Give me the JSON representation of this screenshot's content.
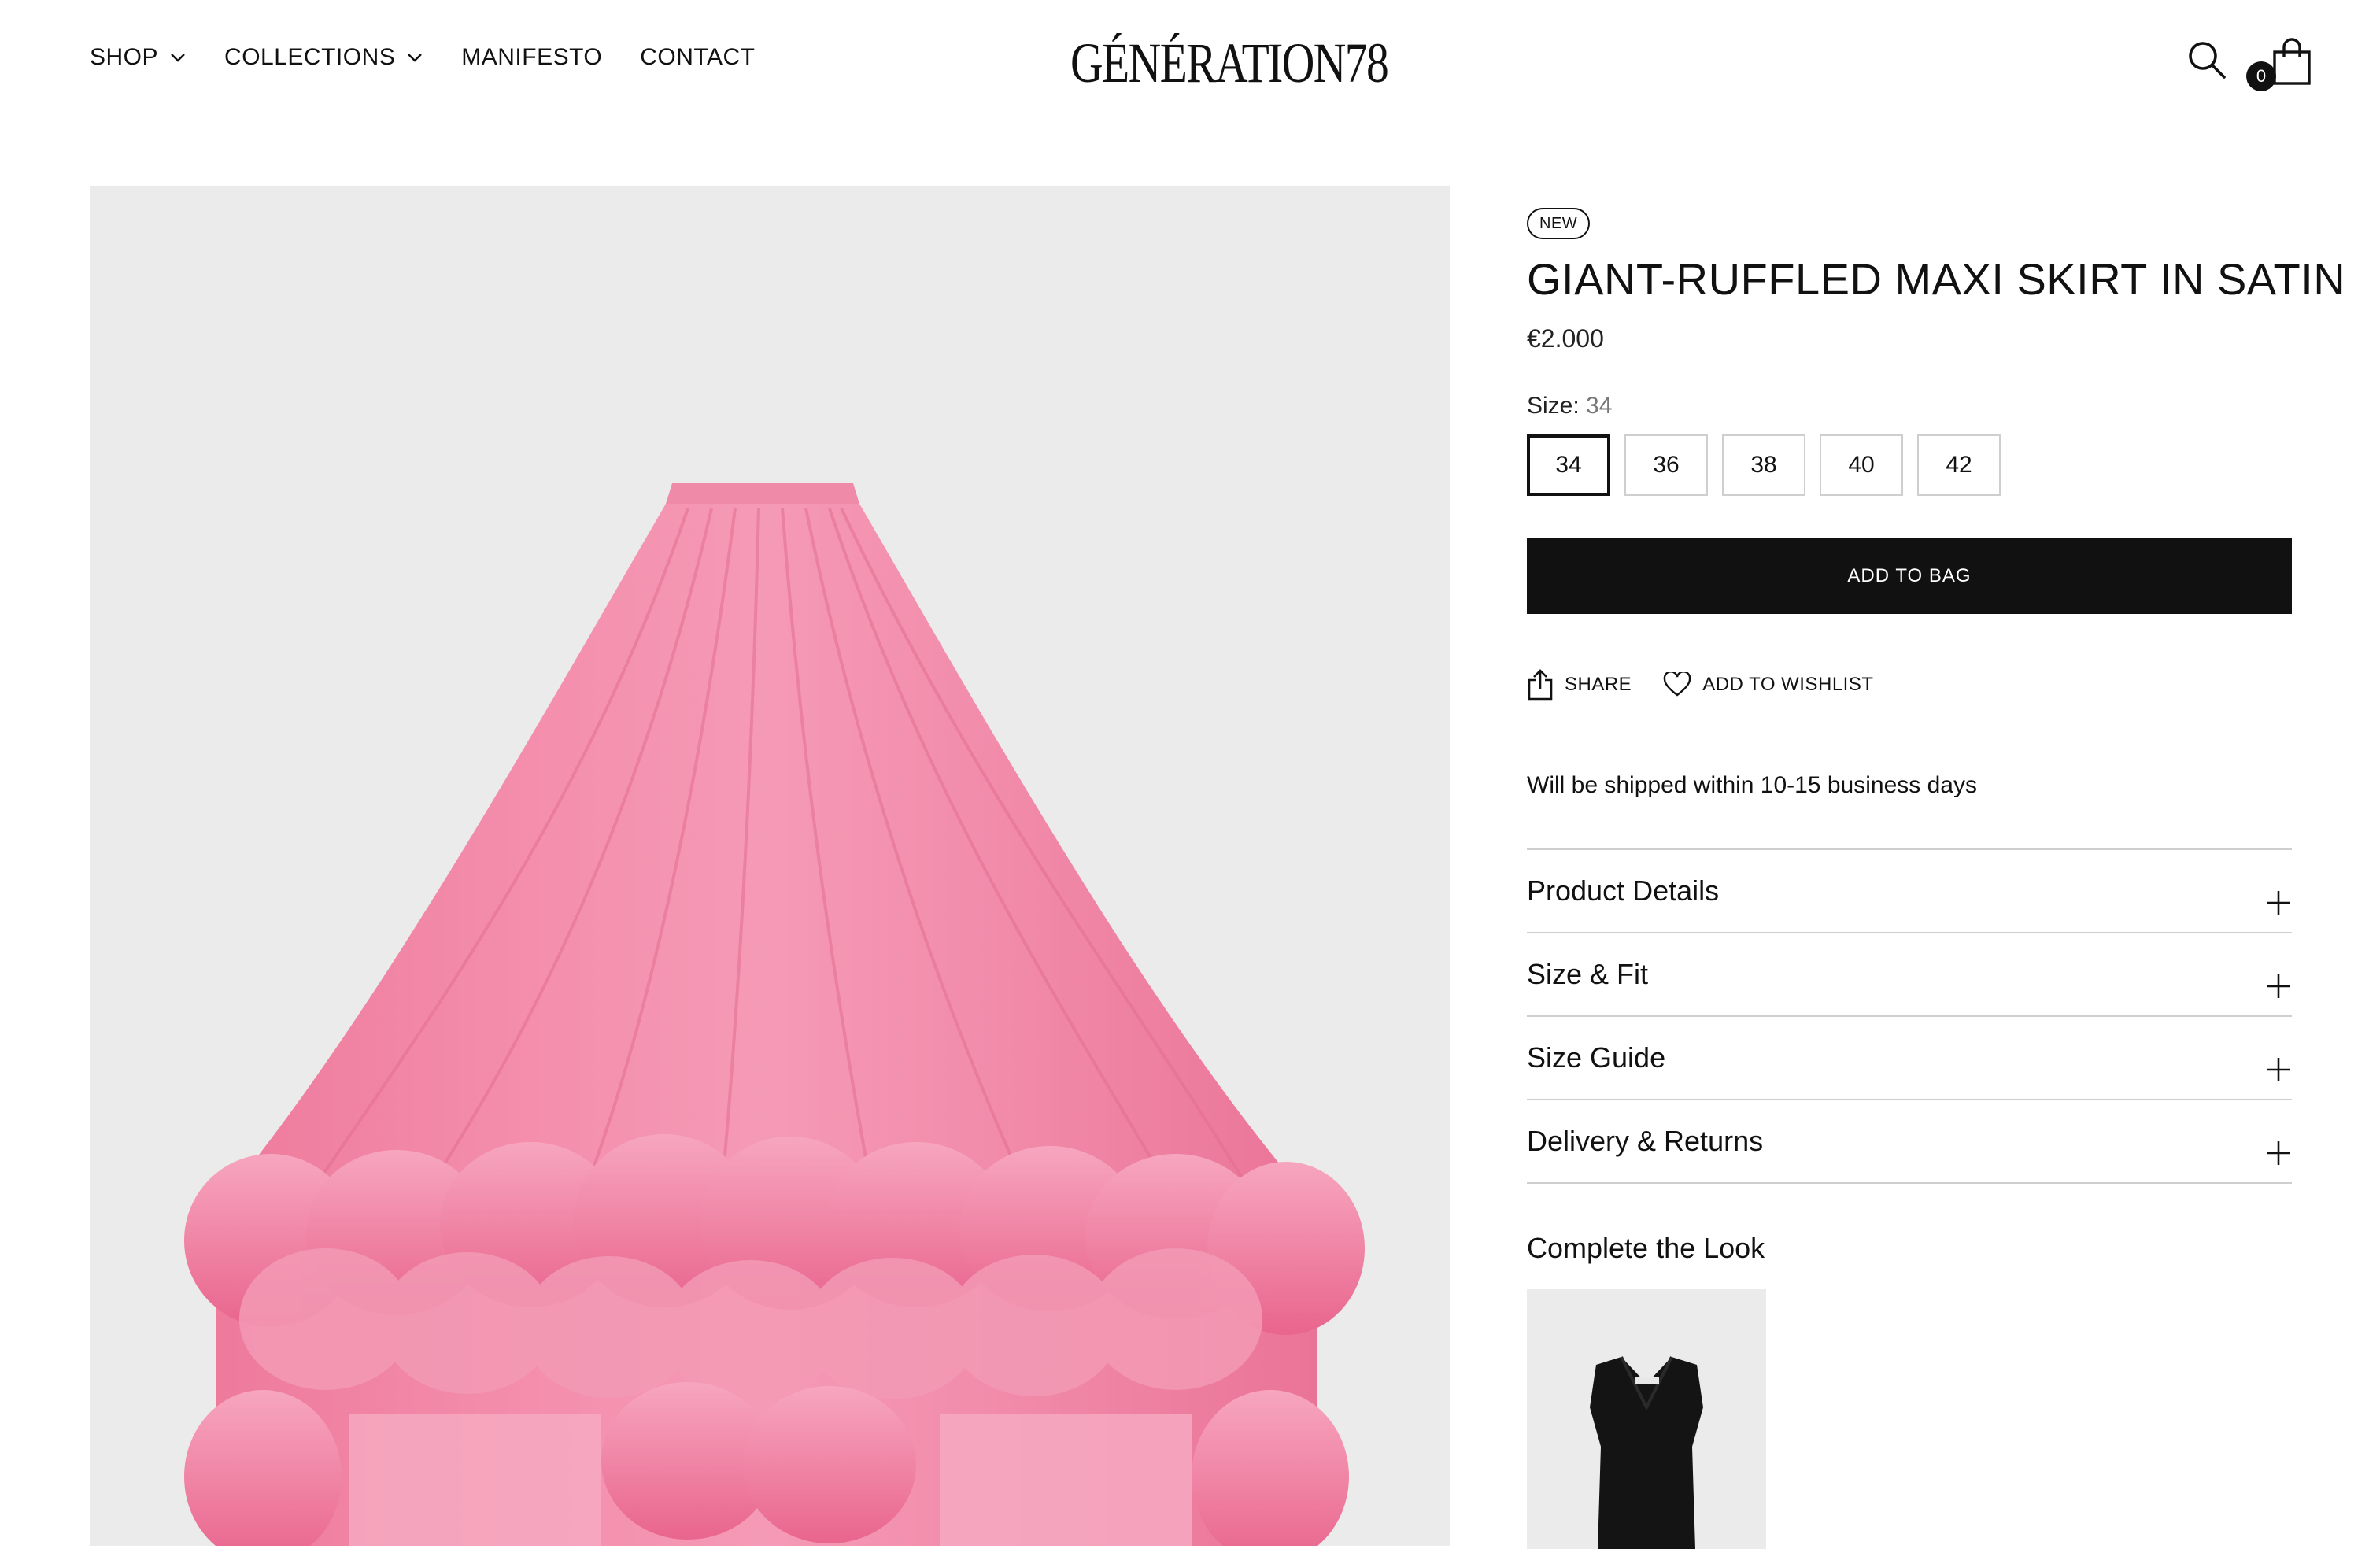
{
  "header": {
    "nav": [
      {
        "label": "SHOP",
        "has_dropdown": true
      },
      {
        "label": "COLLECTIONS",
        "has_dropdown": true
      },
      {
        "label": "MANIFESTO",
        "has_dropdown": false
      },
      {
        "label": "CONTACT",
        "has_dropdown": false
      }
    ],
    "logo": "GÉNÉRATION78",
    "search_icon": "search-icon",
    "bag_icon": "shopping-bag-icon",
    "bag_count": "0"
  },
  "product": {
    "badge": "NEW",
    "title": "GIANT-RUFFLED MAXI SKIRT IN SATIN",
    "price": "€2.000",
    "size_label": "Size:",
    "selected_size": "34",
    "sizes": [
      "34",
      "36",
      "38",
      "40",
      "42"
    ],
    "add_to_bag": "ADD TO BAG",
    "share": "SHARE",
    "wishlist": "ADD TO WISHLIST",
    "shipping": "Will be shipped within 10-15 business days",
    "accordion": [
      {
        "label": "Product Details"
      },
      {
        "label": "Size & Fit"
      },
      {
        "label": "Size Guide"
      },
      {
        "label": "Delivery & Returns"
      }
    ],
    "complete_the_look": "Complete the Look"
  },
  "colors": {
    "text": "#111111",
    "image_bg": "#ebebeb",
    "skirt_pink": "#ef7fa0",
    "border": "#cfcfcf"
  }
}
